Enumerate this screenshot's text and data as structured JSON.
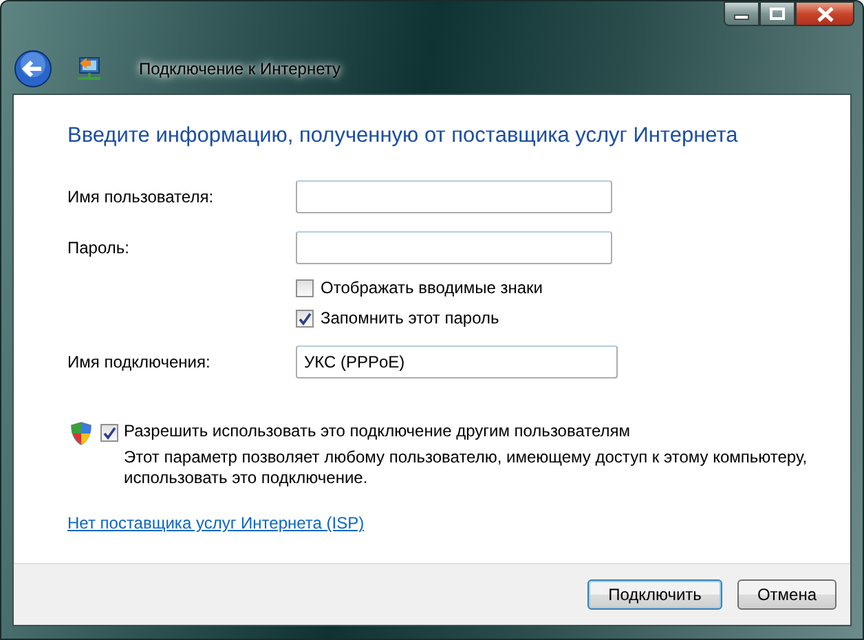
{
  "window": {
    "title": "Подключение к Интернету"
  },
  "heading": "Введите информацию, полученную от поставщика услуг Интернета",
  "fields": [
    {
      "label": "Имя пользователя:"
    },
    {
      "label": "Пароль:"
    }
  ],
  "options": [
    {
      "label": "Отображать вводимые знаки",
      "checked": false
    },
    {
      "label": "Запомнить этот пароль",
      "checked": true
    }
  ],
  "connection_name": {
    "label": "Имя подключения:",
    "value": "УКС (PPPoE)"
  },
  "share": {
    "label": "Разрешить использовать это подключение другим пользователям",
    "checked": true,
    "description": "Этот параметр позволяет любому пользователю, имеющему доступ к этому компьютеру, использовать это подключение."
  },
  "link": "Нет поставщика услуг Интернета (ISP)",
  "buttons": [
    {
      "label": "Подключить",
      "default": true
    },
    {
      "label": "Отмена",
      "default": false
    }
  ]
}
